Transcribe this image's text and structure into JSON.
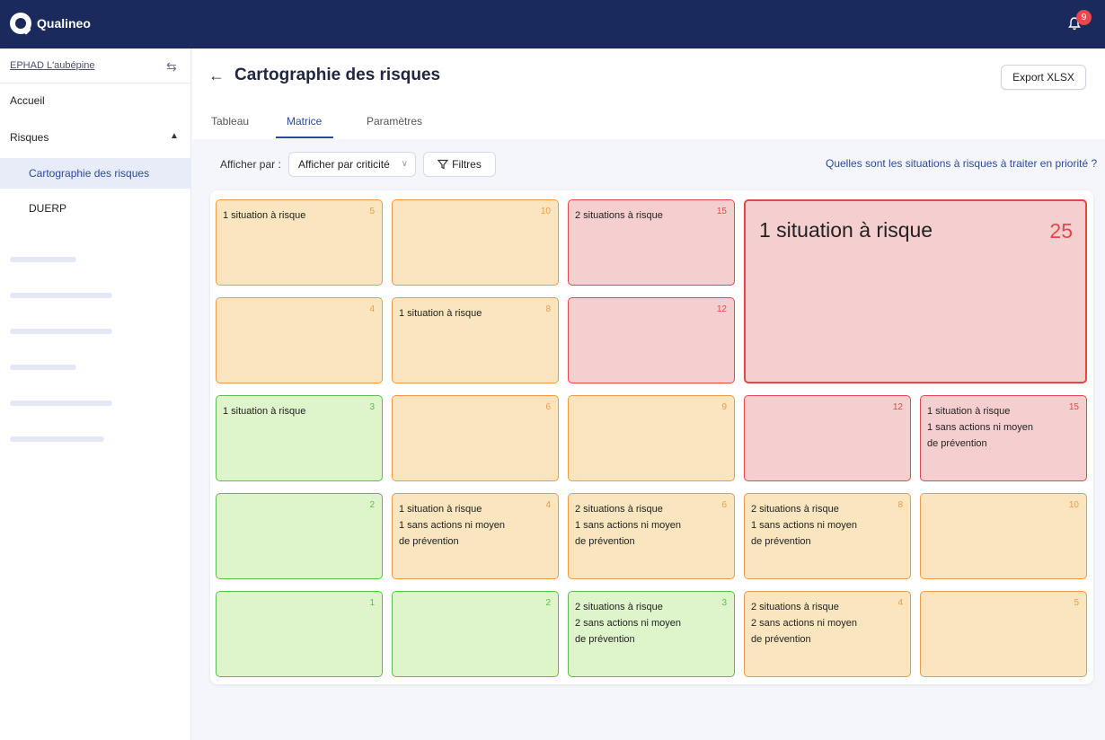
{
  "app": {
    "brand": "Qualineo",
    "notifications": "9"
  },
  "sidebar": {
    "site": "EPHAD L'aubépine",
    "items": [
      {
        "label": "Accueil"
      },
      {
        "label": "Risques"
      },
      {
        "label": "Cartographie des risques"
      },
      {
        "label": "DUERP"
      }
    ]
  },
  "page": {
    "title": "Cartographie des risques",
    "export": "Export XLSX",
    "tabs": [
      "Tableau",
      "Matrice",
      "Paramètres"
    ],
    "active_tab": "Matrice"
  },
  "toolbar": {
    "afficher_label": "Afficher par :",
    "select_value": "Afficher par criticité",
    "filter": "Filtres",
    "help": "Quelles sont les situations à risques à traiter en priorité ?"
  },
  "matrix": {
    "cells": [
      {
        "id": "r1c1",
        "num": "5",
        "color": "orange",
        "lines": [
          "1 situation à risque"
        ]
      },
      {
        "id": "r1c2",
        "num": "10",
        "color": "orange",
        "lines": []
      },
      {
        "id": "r1c3",
        "num": "15",
        "color": "red",
        "lines": [
          "2 situations à risque"
        ]
      },
      {
        "id": "big",
        "num": "25",
        "color": "red",
        "lines": [
          "1 situation à risque"
        ]
      },
      {
        "id": "r2c1",
        "num": "4",
        "color": "orange",
        "lines": []
      },
      {
        "id": "r2c2",
        "num": "8",
        "color": "orange",
        "lines": [
          "1 situation à risque"
        ]
      },
      {
        "id": "r2c3",
        "num": "12",
        "color": "red",
        "lines": []
      },
      {
        "id": "r3c1",
        "num": "3",
        "color": "green",
        "lines": [
          "1 situation à risque"
        ]
      },
      {
        "id": "r3c2",
        "num": "6",
        "color": "orange",
        "lines": []
      },
      {
        "id": "r3c3",
        "num": "9",
        "color": "orange",
        "lines": []
      },
      {
        "id": "r3c4",
        "num": "12",
        "color": "red",
        "lines": []
      },
      {
        "id": "r3c5",
        "num": "15",
        "color": "red",
        "lines": [
          "1 situation à risque",
          "1 sans actions ni moyen",
          "de prévention"
        ]
      },
      {
        "id": "r4c1",
        "num": "2",
        "color": "green",
        "lines": []
      },
      {
        "id": "r4c2",
        "num": "4",
        "color": "orange",
        "lines": [
          "1 situation à risque",
          "1 sans actions ni moyen",
          "de prévention"
        ]
      },
      {
        "id": "r4c3",
        "num": "6",
        "color": "orange",
        "lines": [
          "2 situations à risque",
          "1 sans actions ni moyen",
          "de prévention"
        ]
      },
      {
        "id": "r4c4",
        "num": "8",
        "color": "orange",
        "lines": [
          "2 situations à risque",
          "1 sans actions ni moyen",
          "de prévention"
        ]
      },
      {
        "id": "r4c5",
        "num": "10",
        "color": "orange",
        "lines": []
      },
      {
        "id": "r5c1",
        "num": "1",
        "color": "green",
        "lines": []
      },
      {
        "id": "r5c2",
        "num": "2",
        "color": "green",
        "lines": []
      },
      {
        "id": "r5c3",
        "num": "3",
        "color": "green",
        "lines": [
          "2 situations à risque",
          "2 sans actions ni moyen",
          "de prévention"
        ]
      },
      {
        "id": "r5c4",
        "num": "4",
        "color": "orange",
        "lines": [
          "2 situations à risque",
          "2 sans actions ni moyen",
          "de prévention"
        ]
      },
      {
        "id": "r5c5",
        "num": "5",
        "color": "orange",
        "lines": []
      }
    ]
  }
}
